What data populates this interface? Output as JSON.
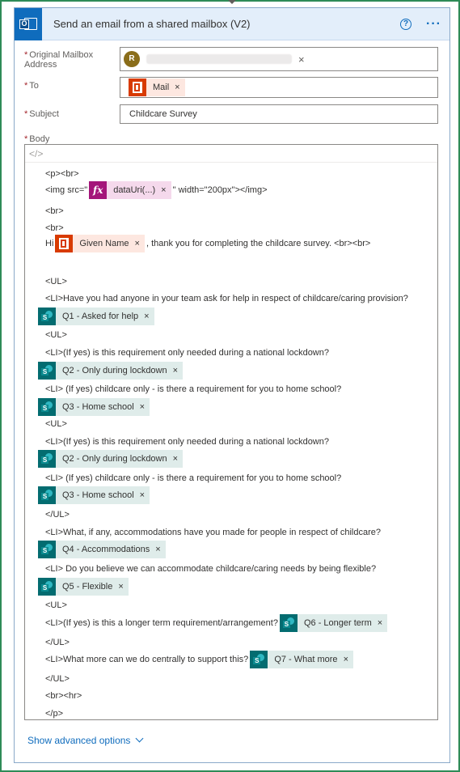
{
  "header": {
    "title": "Send an email from a shared mailbox (V2)",
    "help_glyph": "?",
    "more_glyph": "···"
  },
  "fields": {
    "mailbox": {
      "label_line1": "Original Mailbox",
      "label_line2": "Address",
      "avatar_initial": "R",
      "required": "*"
    },
    "to": {
      "label": "To",
      "required": "*",
      "token": "Mail"
    },
    "subject": {
      "label": "Subject",
      "required": "*",
      "value": "Childcare Survey"
    },
    "body": {
      "label": "Body",
      "required": "*",
      "code_glyph": "</>"
    }
  },
  "body_lines": {
    "l1": "<p><br>",
    "l2_pre": "<img src=\"",
    "l2_token": "dataUri(...)",
    "l2_post": "\" width=\"200px\"></img>",
    "l3": "<br>",
    "l4": "<br>",
    "l5_pre": "Hi",
    "l5_token": "Given Name",
    "l5_post": ", thank you for completing the childcare survey. <br><br>",
    "l6": "<UL>",
    "l7": "<LI>Have you had anyone in your team ask for help in respect of childcare/caring provision?",
    "t1": "Q1 - Asked for help",
    "l8": "<UL>",
    "l9": "<LI>(If yes) is this requirement only needed during a national lockdown?",
    "t2": "Q2 - Only during lockdown",
    "l10": "<LI> (If yes) childcare only - is there a requirement for you to home school?",
    "t3": "Q3 - Home school",
    "l11": "<UL>",
    "l12": "<LI>(If yes) is this requirement only needed during a national lockdown?",
    "t4": "Q2 - Only during lockdown",
    "l13": "<LI> (If yes) childcare only - is there a requirement for you to home school?",
    "t5": "Q3 - Home school",
    "l14": "</UL>",
    "l15": "<LI>What, if any, accommodations have you made for people in respect of childcare?",
    "t6": "Q4 - Accommodations",
    "l16": "<LI> Do you believe we can accommodate childcare/caring needs by being flexible?",
    "t7": "Q5 - Flexible",
    "l17": "<UL>",
    "l18_pre": "<LI>(If yes) is this a longer term requirement/arrangement?",
    "l18_token": "Q6 - Longer term",
    "l19": "</UL>",
    "l20_pre": "<LI>What more can we do centrally to support this?",
    "l20_token": "Q7 - What more",
    "l21": "</UL>",
    "l22": "<br><hr>",
    "l23": "</p>"
  },
  "footer": {
    "advanced_label": "Show advanced options"
  },
  "glyphs": {
    "remove": "×",
    "fx": "fx"
  },
  "colors": {
    "accent": "#0f6cbd",
    "office_token": "#d83b01",
    "fx_token": "#a4157a",
    "sharepoint_token": "#036c70",
    "frame": "#2e8b57"
  }
}
